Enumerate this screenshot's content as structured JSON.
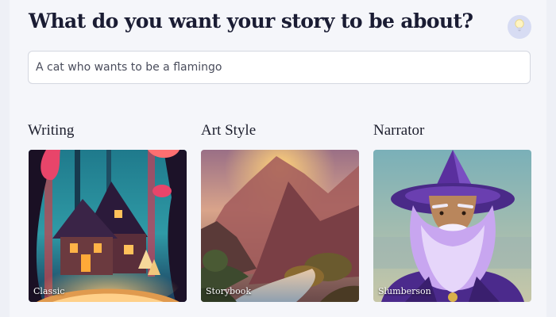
{
  "prompt": {
    "title": "What do you want your story to be about?",
    "input_value": "A cat who wants to be a flamingo",
    "idea_icon": "lightbulb-icon"
  },
  "sections": [
    {
      "label": "Writing",
      "caption": "Classic"
    },
    {
      "label": "Art Style",
      "caption": "Storybook"
    },
    {
      "label": "Narrator",
      "caption": "Slumberson"
    }
  ],
  "colors": {
    "title": "#1a1c33",
    "accent": "#d7dcf3",
    "background": "#f5f6fa"
  }
}
